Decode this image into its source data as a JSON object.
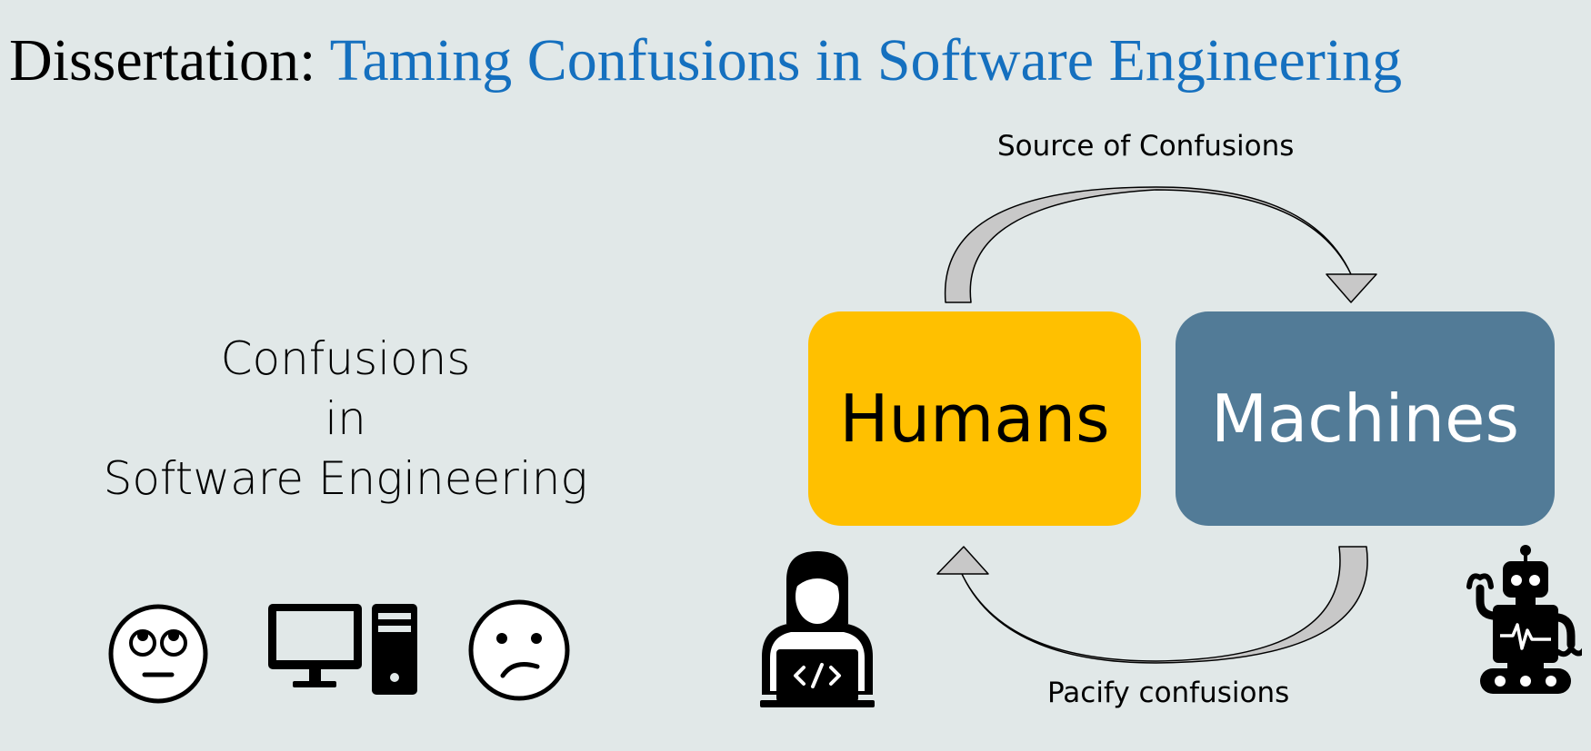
{
  "title": {
    "prefix": "Dissertation:",
    "highlight": "Taming Confusions in Software Engineering"
  },
  "left_text": {
    "line1": "Confusions",
    "line2": "in",
    "line3": "Software Engineering"
  },
  "boxes": {
    "humans": "Humans",
    "machines": "Machines"
  },
  "arrows": {
    "top_label": "Source of Confusions",
    "bottom_label": "Pacify confusions"
  },
  "icons": [
    "eye-roll-face-icon",
    "desktop-computer-icon",
    "confused-face-icon",
    "developer-with-laptop-icon",
    "robot-icon"
  ],
  "colors": {
    "background": "#e1e8e8",
    "title_accent": "#1570bf",
    "humans_box": "#ffc000",
    "machines_box": "#527b97"
  }
}
